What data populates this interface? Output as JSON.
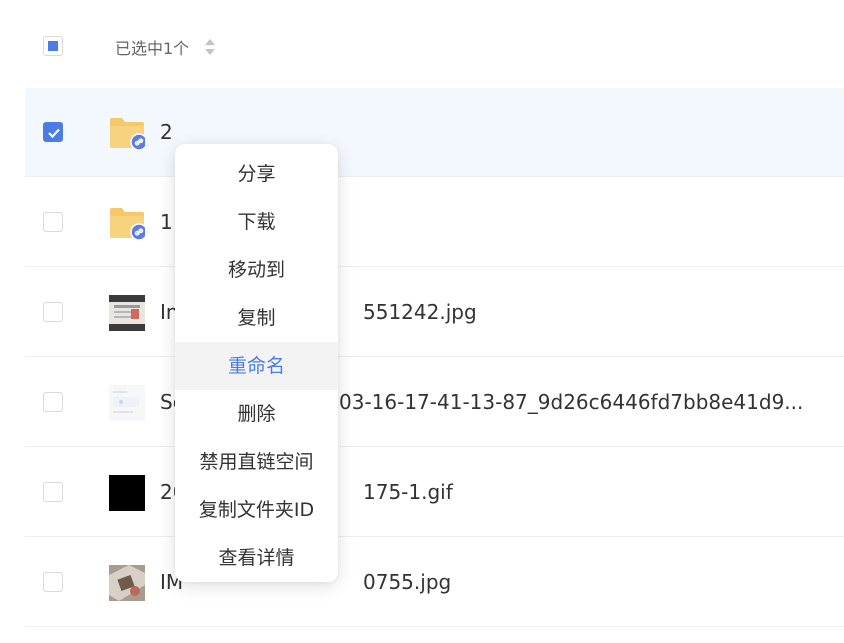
{
  "header": {
    "selected_label": "已选中1个",
    "top_cut_text": "…"
  },
  "rows": [
    {
      "name": "2",
      "type": "folder",
      "checked": true
    },
    {
      "name": "1",
      "type": "folder",
      "checked": false
    },
    {
      "name_prefix": "In",
      "name_suffix": "551242.jpg",
      "type": "image-doc",
      "checked": false
    },
    {
      "name_prefix": "Sc",
      "name_suffix": "03-16-17-41-13-87_9d26c6446fd7bb8e41d9...",
      "type": "image-light",
      "checked": false
    },
    {
      "name_prefix": "20",
      "name_suffix": "175-1.gif",
      "type": "image-black",
      "checked": false
    },
    {
      "name_prefix": "IM",
      "name_suffix": "0755.jpg",
      "type": "image-photo",
      "checked": false
    }
  ],
  "context_menu": {
    "items": [
      "分享",
      "下载",
      "移动到",
      "复制",
      "重命名",
      "删除",
      "禁用直链空间",
      "复制文件夹ID",
      "查看详情"
    ],
    "active_index": 4
  },
  "colors": {
    "accent": "#4b7be5",
    "selected_row_bg": "#f2f8fd",
    "folder": "#f5c86a",
    "link_badge": "#5b7be8"
  }
}
